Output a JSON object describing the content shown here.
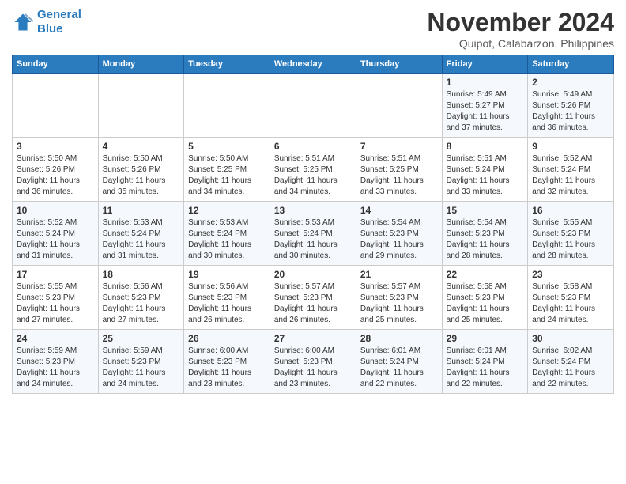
{
  "header": {
    "logo_line1": "General",
    "logo_line2": "Blue",
    "month": "November 2024",
    "location": "Quipot, Calabarzon, Philippines"
  },
  "weekdays": [
    "Sunday",
    "Monday",
    "Tuesday",
    "Wednesday",
    "Thursday",
    "Friday",
    "Saturday"
  ],
  "weeks": [
    [
      {
        "day": "",
        "info": ""
      },
      {
        "day": "",
        "info": ""
      },
      {
        "day": "",
        "info": ""
      },
      {
        "day": "",
        "info": ""
      },
      {
        "day": "",
        "info": ""
      },
      {
        "day": "1",
        "info": "Sunrise: 5:49 AM\nSunset: 5:27 PM\nDaylight: 11 hours\nand 37 minutes."
      },
      {
        "day": "2",
        "info": "Sunrise: 5:49 AM\nSunset: 5:26 PM\nDaylight: 11 hours\nand 36 minutes."
      }
    ],
    [
      {
        "day": "3",
        "info": "Sunrise: 5:50 AM\nSunset: 5:26 PM\nDaylight: 11 hours\nand 36 minutes."
      },
      {
        "day": "4",
        "info": "Sunrise: 5:50 AM\nSunset: 5:26 PM\nDaylight: 11 hours\nand 35 minutes."
      },
      {
        "day": "5",
        "info": "Sunrise: 5:50 AM\nSunset: 5:25 PM\nDaylight: 11 hours\nand 34 minutes."
      },
      {
        "day": "6",
        "info": "Sunrise: 5:51 AM\nSunset: 5:25 PM\nDaylight: 11 hours\nand 34 minutes."
      },
      {
        "day": "7",
        "info": "Sunrise: 5:51 AM\nSunset: 5:25 PM\nDaylight: 11 hours\nand 33 minutes."
      },
      {
        "day": "8",
        "info": "Sunrise: 5:51 AM\nSunset: 5:24 PM\nDaylight: 11 hours\nand 33 minutes."
      },
      {
        "day": "9",
        "info": "Sunrise: 5:52 AM\nSunset: 5:24 PM\nDaylight: 11 hours\nand 32 minutes."
      }
    ],
    [
      {
        "day": "10",
        "info": "Sunrise: 5:52 AM\nSunset: 5:24 PM\nDaylight: 11 hours\nand 31 minutes."
      },
      {
        "day": "11",
        "info": "Sunrise: 5:53 AM\nSunset: 5:24 PM\nDaylight: 11 hours\nand 31 minutes."
      },
      {
        "day": "12",
        "info": "Sunrise: 5:53 AM\nSunset: 5:24 PM\nDaylight: 11 hours\nand 30 minutes."
      },
      {
        "day": "13",
        "info": "Sunrise: 5:53 AM\nSunset: 5:24 PM\nDaylight: 11 hours\nand 30 minutes."
      },
      {
        "day": "14",
        "info": "Sunrise: 5:54 AM\nSunset: 5:23 PM\nDaylight: 11 hours\nand 29 minutes."
      },
      {
        "day": "15",
        "info": "Sunrise: 5:54 AM\nSunset: 5:23 PM\nDaylight: 11 hours\nand 28 minutes."
      },
      {
        "day": "16",
        "info": "Sunrise: 5:55 AM\nSunset: 5:23 PM\nDaylight: 11 hours\nand 28 minutes."
      }
    ],
    [
      {
        "day": "17",
        "info": "Sunrise: 5:55 AM\nSunset: 5:23 PM\nDaylight: 11 hours\nand 27 minutes."
      },
      {
        "day": "18",
        "info": "Sunrise: 5:56 AM\nSunset: 5:23 PM\nDaylight: 11 hours\nand 27 minutes."
      },
      {
        "day": "19",
        "info": "Sunrise: 5:56 AM\nSunset: 5:23 PM\nDaylight: 11 hours\nand 26 minutes."
      },
      {
        "day": "20",
        "info": "Sunrise: 5:57 AM\nSunset: 5:23 PM\nDaylight: 11 hours\nand 26 minutes."
      },
      {
        "day": "21",
        "info": "Sunrise: 5:57 AM\nSunset: 5:23 PM\nDaylight: 11 hours\nand 25 minutes."
      },
      {
        "day": "22",
        "info": "Sunrise: 5:58 AM\nSunset: 5:23 PM\nDaylight: 11 hours\nand 25 minutes."
      },
      {
        "day": "23",
        "info": "Sunrise: 5:58 AM\nSunset: 5:23 PM\nDaylight: 11 hours\nand 24 minutes."
      }
    ],
    [
      {
        "day": "24",
        "info": "Sunrise: 5:59 AM\nSunset: 5:23 PM\nDaylight: 11 hours\nand 24 minutes."
      },
      {
        "day": "25",
        "info": "Sunrise: 5:59 AM\nSunset: 5:23 PM\nDaylight: 11 hours\nand 24 minutes."
      },
      {
        "day": "26",
        "info": "Sunrise: 6:00 AM\nSunset: 5:23 PM\nDaylight: 11 hours\nand 23 minutes."
      },
      {
        "day": "27",
        "info": "Sunrise: 6:00 AM\nSunset: 5:23 PM\nDaylight: 11 hours\nand 23 minutes."
      },
      {
        "day": "28",
        "info": "Sunrise: 6:01 AM\nSunset: 5:24 PM\nDaylight: 11 hours\nand 22 minutes."
      },
      {
        "day": "29",
        "info": "Sunrise: 6:01 AM\nSunset: 5:24 PM\nDaylight: 11 hours\nand 22 minutes."
      },
      {
        "day": "30",
        "info": "Sunrise: 6:02 AM\nSunset: 5:24 PM\nDaylight: 11 hours\nand 22 minutes."
      }
    ]
  ]
}
